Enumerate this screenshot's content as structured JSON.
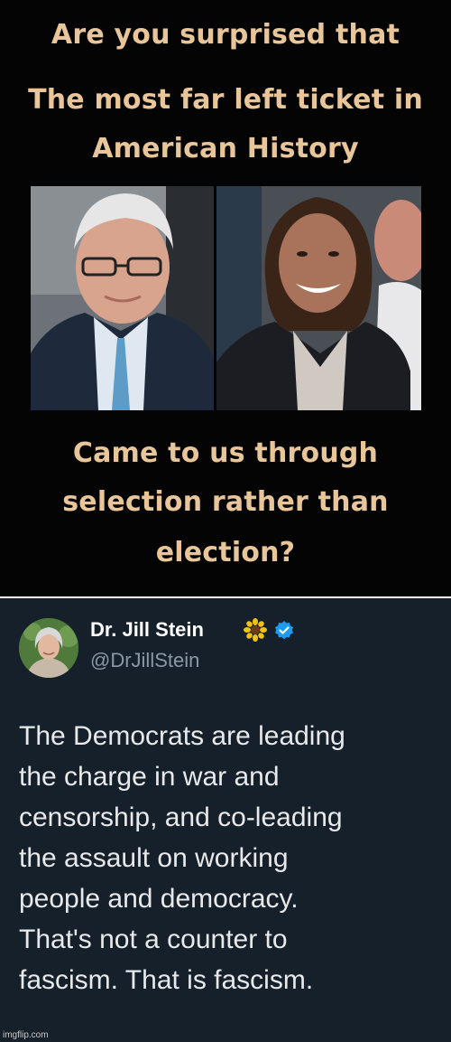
{
  "meme": {
    "headline_lines": [
      "Are you surprised that",
      "The most far left ticket in",
      "American History"
    ],
    "caption_lines": [
      "Came to us through",
      "selection rather than",
      "election?"
    ],
    "text_color": "#e8c69a"
  },
  "tweet": {
    "display_name": "Dr. Jill Stein",
    "name_emoji": "sunflower-icon",
    "verified": "verified-badge-icon",
    "handle": "@DrJillStein",
    "body_lines": [
      "The Democrats are leading",
      "the charge in war and",
      "censorship, and co-leading",
      "the assault on working",
      "people and democracy.",
      "That's not a counter to",
      "fascism. That is fascism."
    ],
    "background": "#15202b",
    "verified_color": "#1d9bf0"
  },
  "watermark": "imgflip.com"
}
